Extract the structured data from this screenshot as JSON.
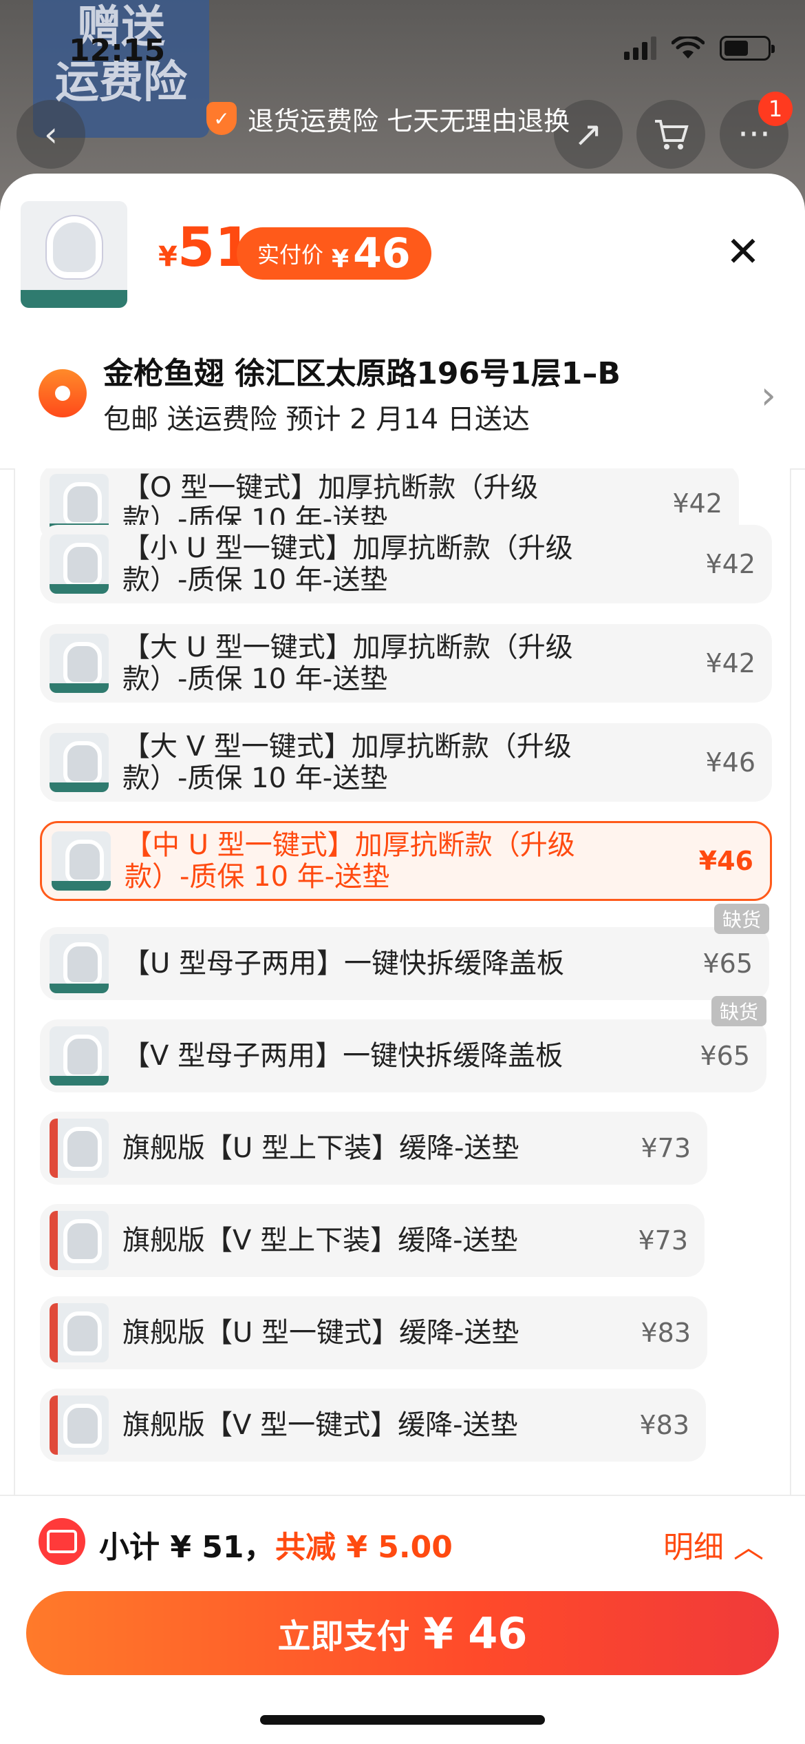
{
  "status": {
    "time": "12:15"
  },
  "background": {
    "promo_line1": "赠送",
    "promo_line2": "运费险",
    "cart_badge": "1",
    "notice": "退货运费险 七天无理由退换"
  },
  "product": {
    "price_symbol": "¥",
    "price": "51",
    "real_label": "实付价",
    "real_symbol": "¥",
    "real_price": "46",
    "close": "✕"
  },
  "address": {
    "line1": "金枪鱼翅 徐汇区太原路196号1层1–B",
    "line2": "包邮  送运费险  预计 2 月14 日送达"
  },
  "options": [
    {
      "line1": "【O 型一键式】加厚抗断款（升级",
      "line2": "款）-质保 10 年-送垫",
      "price": "¥42"
    },
    {
      "line1": "【小 U 型一键式】加厚抗断款（升级",
      "line2": "款）-质保 10 年-送垫",
      "price": "¥42"
    },
    {
      "line1": "【大 U 型一键式】加厚抗断款（升级",
      "line2": "款）-质保 10 年-送垫",
      "price": "¥42"
    },
    {
      "line1": "【大 V 型一键式】加厚抗断款（升级",
      "line2": "款）-质保 10 年-送垫",
      "price": "¥46"
    },
    {
      "line1": "【中 U 型一键式】加厚抗断款（升级",
      "line2": "款）-质保 10 年-送垫",
      "price": "¥46",
      "selected": true
    },
    {
      "line1": "【U 型母子两用】一键快拆缓降盖板",
      "price": "¥65",
      "badge": "缺货"
    },
    {
      "line1": "【V 型母子两用】一键快拆缓降盖板",
      "price": "¥65",
      "badge": "缺货"
    },
    {
      "line1": "旗舰版【U 型上下装】缓降-送垫",
      "price": "¥73"
    },
    {
      "line1": "旗舰版【V 型上下装】缓降-送垫",
      "price": "¥73"
    },
    {
      "line1": "旗舰版【U 型一键式】缓降-送垫",
      "price": "¥83"
    },
    {
      "line1": "旗舰版【V 型一键式】缓降-送垫",
      "price": "¥83"
    }
  ],
  "bottom": {
    "subtotal": "小计 ¥ 51，",
    "discount": "共减 ¥ 5.00",
    "detail": "明细 ︿",
    "pay_label": "立即支付",
    "pay_amount": "¥ 46"
  }
}
